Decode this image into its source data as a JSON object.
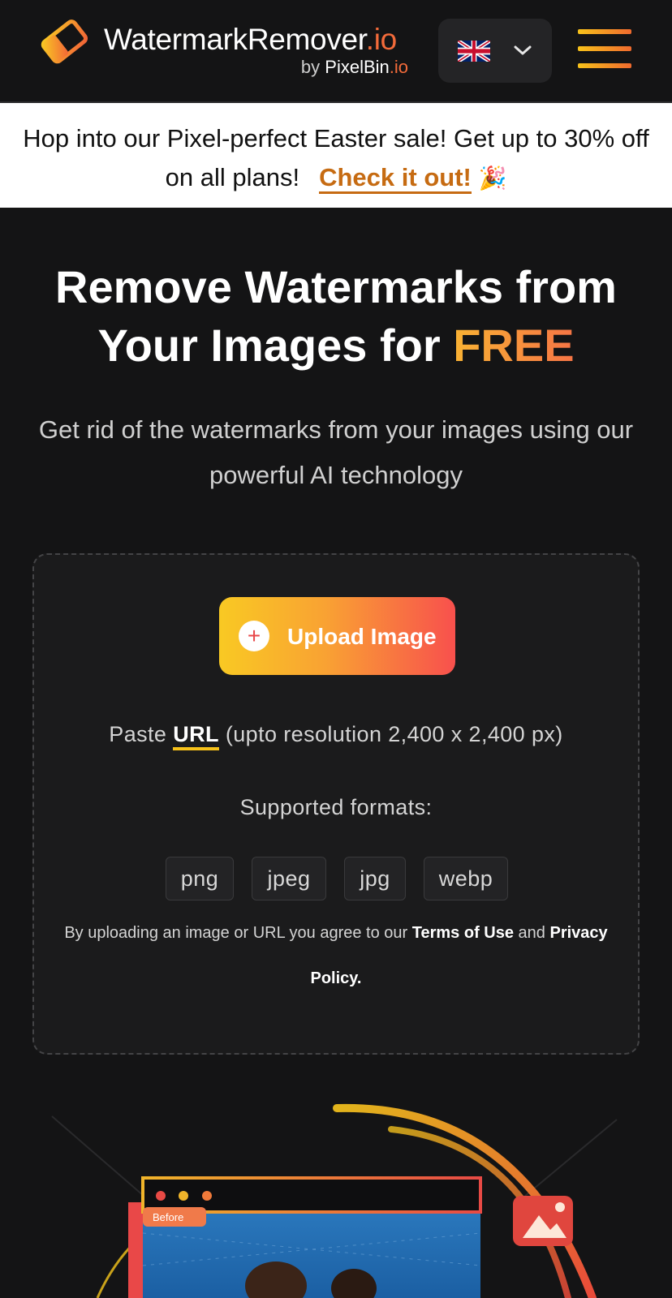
{
  "header": {
    "logo_name": "WatermarkRemover",
    "logo_suffix": ".io",
    "by_prefix": "by",
    "by_name": "PixelBin",
    "by_suffix": ".io",
    "language_flag": "uk-flag-icon",
    "language_dropdown_icon": "chevron-down-icon",
    "menu_icon": "hamburger-menu-icon"
  },
  "promo": {
    "text": "Hop into our Pixel-perfect Easter sale! Get up to 30% off on all plans!",
    "link_label": "Check it out!",
    "emoji": "🎉"
  },
  "hero": {
    "title_main": "Remove Watermarks from Your Images for",
    "title_highlight": "FREE",
    "subtitle": "Get rid of the watermarks from your images using our powerful AI technology"
  },
  "upload": {
    "button_label": "Upload Image",
    "button_icon": "plus-icon",
    "paste_prefix": "Paste",
    "paste_link": "URL",
    "paste_suffix": "(upto resolution 2,400 x 2,400 px)",
    "formats_label": "Supported formats:",
    "formats": [
      "png",
      "jpeg",
      "jpg",
      "webp"
    ],
    "terms_prefix": "By uploading an image or URL you agree to our",
    "terms_link": "Terms of Use",
    "terms_and": "and",
    "privacy_link": "Privacy Policy."
  },
  "illustration": {
    "badge_label": "Before",
    "image_icon": "image-icon"
  },
  "colors": {
    "background": "#141415",
    "accent_yellow": "#f7c21a",
    "accent_orange": "#f06a2e",
    "accent_red": "#f8504d",
    "promo_link": "#c66b12"
  }
}
